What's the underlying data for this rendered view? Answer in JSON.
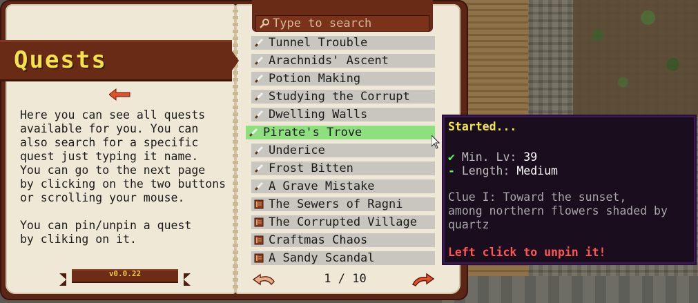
{
  "book": {
    "title": "Quests",
    "help_text": "Here you can see all quests\navailable for you. You can\nalso search for a specific\nquest just typing it name.\nYou can go to the next page\nby clicking on the two buttons\nor scrolling your mouse.\n\nYou can pin/unpin a quest\nby cliking on it.",
    "version": "v0.0.22"
  },
  "search": {
    "placeholder": "Type to search"
  },
  "quests": [
    {
      "label": "Tunnel Trouble",
      "icon": "sword-icon"
    },
    {
      "label": "Arachnids' Ascent",
      "icon": "sword-icon"
    },
    {
      "label": "Potion Making",
      "icon": "sword-icon"
    },
    {
      "label": "Studying the Corrupt",
      "icon": "sword-icon"
    },
    {
      "label": "Dwelling Walls",
      "icon": "sword-icon"
    },
    {
      "label": "Pirate's Trove",
      "icon": "sword-icon"
    },
    {
      "label": "Underice",
      "icon": "sword-icon"
    },
    {
      "label": "Frost Bitten",
      "icon": "sword-icon"
    },
    {
      "label": "A Grave Mistake",
      "icon": "sword-icon"
    },
    {
      "label": "The Sewers of Ragni",
      "icon": "book-icon"
    },
    {
      "label": "The Corrupted Village",
      "icon": "book-icon"
    },
    {
      "label": "Craftmas Chaos",
      "icon": "book-icon"
    },
    {
      "label": "A Sandy Scandal",
      "icon": "book-icon"
    }
  ],
  "pagination": {
    "label": "1 / 10"
  },
  "tooltip": {
    "status": "Started...",
    "level_check": "✔",
    "level_label": "Min. Lv: ",
    "level_value": "39",
    "length_dash": "-",
    "length_label": "Length: ",
    "length_value": "Medium",
    "clue": "Clue I: Toward the sunset,\namong northern flowers shaded by\nquartz",
    "action": "Left click to unpin it!"
  },
  "colors": {
    "hover_row": "#8ee07e",
    "row": "#c9c6bf",
    "ribbon": "#6a2b16",
    "title": "#f4e14b",
    "status": "#f2e83d",
    "action": "#ff5555"
  }
}
